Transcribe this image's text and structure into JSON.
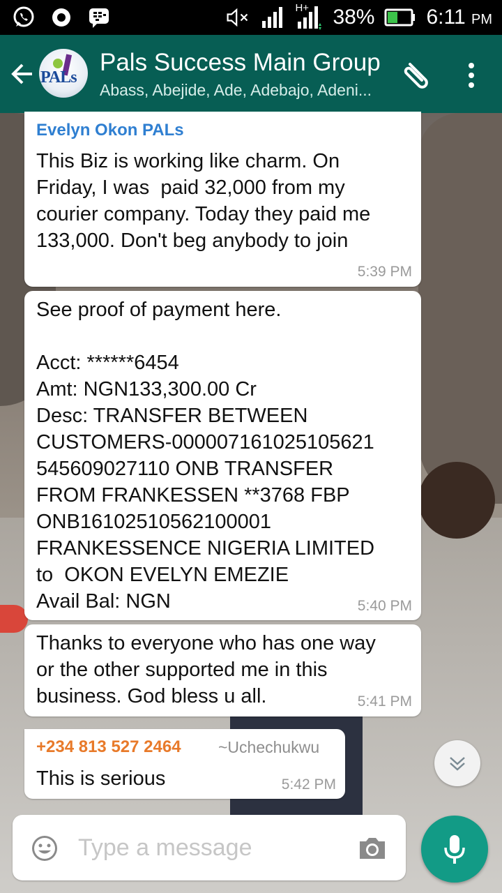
{
  "status_bar": {
    "network_type": "H+",
    "battery": "38%",
    "time": "6:11",
    "time_suffix": "PM"
  },
  "header": {
    "avatar_text": "PALs",
    "title": "Pals Success Main Group",
    "members": "Abass, Abejide, Ade, Adebajo, Adeni..."
  },
  "messages": [
    {
      "sender": "Evelyn Okon PALs",
      "text": "This Biz is working like charm. On\nFriday, I was  paid 32,000 from my\ncourier company. Today they paid me\n133,000. Don't beg anybody to join",
      "time": "5:39 PM"
    },
    {
      "text": "See proof of payment here.\n\nAcct: ******6454\nAmt: NGN133,300.00 Cr\nDesc: TRANSFER BETWEEN\nCUSTOMERS-000007161025105621\n545609027110 ONB TRANSFER\nFROM FRANKESSEN **3768 FBP\nONB16102510562100001\nFRANKESSENCE NIGERIA LIMITED\nto  OKON EVELYN EMEZIE\nAvail Bal: NGN",
      "time": "5:40 PM"
    },
    {
      "text": "Thanks to everyone who has one way\nor the other supported me in this\nbusiness. God bless u all.",
      "time": "5:41 PM"
    },
    {
      "sender": "+234 813 527 2464",
      "alias": "~Uchechukwu",
      "text": "This is serious",
      "time": "5:42 PM"
    }
  ],
  "composer": {
    "placeholder": "Type a message"
  },
  "colors": {
    "app_bar": "#075e54",
    "sender_evelyn": "#2f7fd1",
    "sender_phone": "#e87a2a",
    "mic_button": "#129b86"
  }
}
